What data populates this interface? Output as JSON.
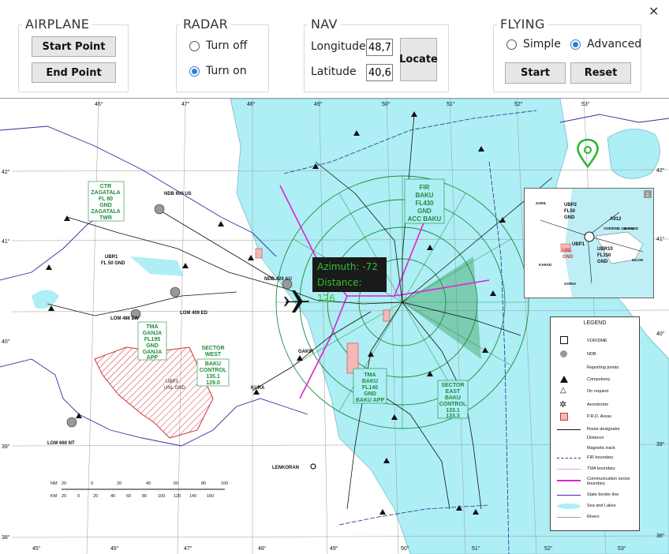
{
  "window": {
    "close_glyph": "×"
  },
  "airplane": {
    "title": "AIRPLANE",
    "start_point_label": "Start Point",
    "end_point_label": "End Point"
  },
  "radar": {
    "title": "RADAR",
    "options": [
      "Turn off",
      "Turn on"
    ],
    "selected": "Turn on"
  },
  "nav": {
    "title": "NAV",
    "longitude_label": "Longitude",
    "longitude_value": "48,7",
    "latitude_label": "Latitude",
    "latitude_value": "40,6",
    "locate_label": "Locate"
  },
  "flying": {
    "title": "FLYING",
    "options": [
      "Simple",
      "Advanced"
    ],
    "selected": "Advanced",
    "start_label": "Start",
    "reset_label": "Reset"
  },
  "radar_readout": {
    "azimuth_text": "Azimuth: -72",
    "distance_text": "Distance: 126"
  },
  "map": {
    "top_longitudes": [
      "46°",
      "47°",
      "48°",
      "49°",
      "50°",
      "51°",
      "52°",
      "53°"
    ],
    "bottom_longitudes": [
      "45°",
      "46°",
      "47°",
      "48°",
      "49°",
      "50°",
      "51°",
      "52°",
      "53°"
    ],
    "left_latitudes": [
      "42°",
      "41°",
      "40°",
      "39°",
      "38°"
    ],
    "right_latitudes": [
      "42°",
      "41°",
      "40°",
      "39°",
      "38°"
    ],
    "sectors": {
      "ctr": [
        "CTR",
        "ZAGATALA",
        "FL 80",
        "GND",
        "ZAGATALA",
        "TWR"
      ],
      "fir": [
        "FIR",
        "BAKU",
        "FL430",
        "GND",
        "ACC BAKU"
      ],
      "tma_ganja": [
        "TMA",
        "GANJA",
        "FL195",
        "GND",
        "GANJA",
        "APP"
      ],
      "sector_west": [
        "SECTOR",
        "WEST",
        "BAKU",
        "CONTROL",
        "135.1",
        "129.0"
      ],
      "tma_baku": [
        "TMA",
        "BAKU",
        "FL140",
        "GND",
        "BAKU APP"
      ],
      "sector_east": [
        "SECTOR",
        "EAST",
        "BAKU",
        "CONTROL",
        "133.1",
        "133.3"
      ]
    },
    "points": {
      "ganja_lom": "LOM 486 ZW",
      "yevlakh_lom": "LOM 409 ED",
      "zagatala_ndb": "NDB 600 US",
      "ndb_420": "NDB 420 AU",
      "nakhchivan": "LOM 660 NT",
      "lenkoran": "LENKORAN",
      "ubp3": "UBP3",
      "ubp3_sub": "UNL GND",
      "ubr1": "UBR1",
      "ubr1_sub": "FL 50 GND",
      "kura": "KURA",
      "gakir": "GAKIR"
    },
    "scale": {
      "nm_label": "NM",
      "km_label": "KM",
      "nm_ticks": [
        "20",
        "0",
        "20",
        "40",
        "60",
        "80",
        "100"
      ],
      "km_ticks": [
        "20",
        "0",
        "20",
        "40",
        "60",
        "80",
        "100",
        "120",
        "140",
        "160"
      ]
    },
    "legend": {
      "title": "LEGEND",
      "items": [
        "VOR/DME",
        "NDB",
        "Reporting points:",
        "Compulsory",
        "On request",
        "Aerodrome",
        "P.R.D. Areas",
        "Route designator",
        "Distance",
        "Magnetic track",
        "FIR boundary",
        "TMA boundary",
        "Communication sector boundary",
        "State border line",
        "Sea and Lakes",
        "Rivers"
      ]
    },
    "inset": {
      "index": "1",
      "labels": [
        "UBP2",
        "FL50",
        "GND",
        "UBP1",
        "UNL",
        "GND",
        "UBR10",
        "FL150",
        "GND",
        "A912",
        "VOR/DME 114.1 BVD",
        "SARIL",
        "KARAD",
        "GORIO",
        "DILOR",
        "BAKU"
      ]
    },
    "colors": {
      "sea": "#aeeef5",
      "land": "#ffffff",
      "fir_green": "#1e8c3a",
      "comm_magenta": "#e020d0",
      "route": "#111111",
      "border": "#3a2aa0"
    }
  }
}
